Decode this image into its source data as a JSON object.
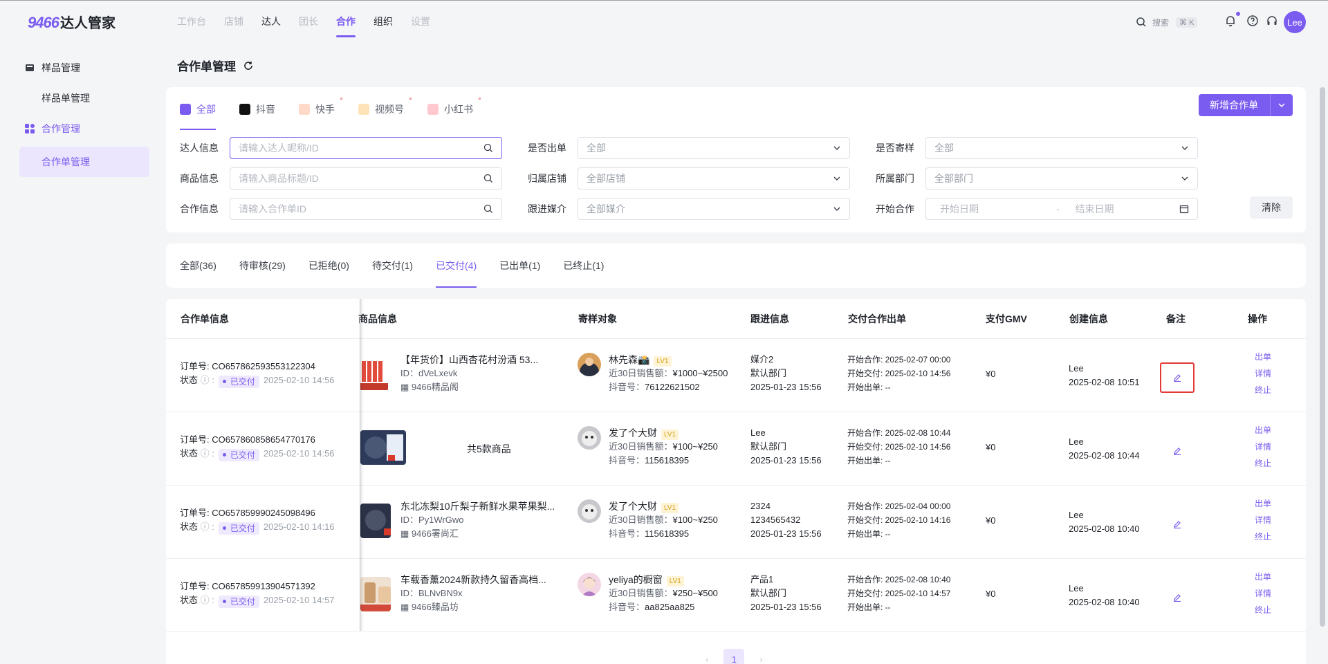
{
  "app": {
    "logo_num": "9466",
    "logo_text": "达人管家",
    "nav": [
      "工作台",
      "店铺",
      "达人",
      "团长",
      "合作",
      "组织",
      "设置"
    ],
    "search_label": "搜索",
    "search_kbd": "⌘ K",
    "avatar": "Lee"
  },
  "sidebar": {
    "group1": "样品管理",
    "item1": "样品单管理",
    "group2": "合作管理",
    "item2": "合作单管理"
  },
  "page": {
    "title": "合作单管理"
  },
  "platform_tabs": [
    {
      "label": "全部"
    },
    {
      "label": "抖音"
    },
    {
      "label": "快手"
    },
    {
      "label": "视频号"
    },
    {
      "label": "小红书"
    }
  ],
  "new_button": "新增合作单",
  "filters": {
    "talent_label": "达人信息",
    "talent_ph": "请输入达人昵称/ID",
    "product_label": "商品信息",
    "product_ph": "请输入商品标题/ID",
    "coop_label": "合作信息",
    "coop_ph": "请输入合作单ID",
    "order_label": "是否出单",
    "order_val": "全部",
    "store_label": "归属店铺",
    "store_val": "全部店铺",
    "media_label": "跟进媒介",
    "media_val": "全部媒介",
    "sample_label": "是否寄样",
    "sample_val": "全部",
    "dept_label": "所属部门",
    "dept_val": "全部部门",
    "start_label": "开始合作",
    "start_ph": "开始日期",
    "dash": "-",
    "end_ph": "结束日期",
    "clear": "清除"
  },
  "status_tabs": [
    "全部(36)",
    "待审核(29)",
    "已拒绝(0)",
    "待交付(1)",
    "已交付(4)",
    "已出单(1)",
    "已终止(1)"
  ],
  "columns": [
    "合作单信息",
    "商品信息",
    "寄样对象",
    "跟进信息",
    "交付合作出单",
    "支付GMV",
    "创建信息",
    "备注",
    "操作"
  ],
  "rows": [
    {
      "order_prefix": "订单号:",
      "order_no": "CO6578625935531223​04",
      "state_label": "状态",
      "state": "已交付",
      "state_time": "2025-02-10 14:56",
      "product_title": "【年货价】山西杏花村汾酒 53...",
      "product_id": "ID：dVeLxevk",
      "store": "9466精品阁",
      "talent": "林先森📸",
      "lv": "LV1",
      "sales_label": "近30日销售额：",
      "sales": "¥1000~¥2500",
      "dy_label": "抖音号：",
      "dy": "76122621502",
      "follow1": "媒介2",
      "follow2": "默认部门",
      "follow3": "2025-01-23 15:56",
      "start": "开始合作: 2025-02-07 00:00",
      "deliver": "开始交付: 2025-02-10 14:56",
      "out": "开始出单: --",
      "gmv": "¥0",
      "creator": "Lee",
      "created": "2025-02-08 10:51",
      "ops": [
        "出单",
        "详情",
        "终止"
      ]
    },
    {
      "order_prefix": "订单号:",
      "order_no": "CO6578608586547701​76",
      "state_label": "状态",
      "state": "已交付",
      "state_time": "2025-02-10 14:56",
      "product_summary": "共5款商品",
      "talent": "发了个大财",
      "lv": "LV1",
      "sales_label": "近30日销售额：",
      "sales": "¥100~¥250",
      "dy_label": "抖音号：",
      "dy": "115618395",
      "follow1": "Lee",
      "follow2": "默认部门",
      "follow3": "2025-01-23 15:56",
      "start": "开始合作: 2025-02-08 10:44",
      "deliver": "开始交付: 2025-02-10 14:56",
      "out": "开始出单: --",
      "gmv": "¥0",
      "creator": "Lee",
      "created": "2025-02-08 10:44",
      "ops": [
        "出单",
        "详情",
        "终止"
      ]
    },
    {
      "order_prefix": "订单号:",
      "order_no": "CO6578599902450984​96",
      "state_label": "状态",
      "state": "已交付",
      "state_time": "2025-02-10 14:16",
      "product_title": "东北冻梨10斤梨子新鲜水果苹果梨...",
      "product_id": "ID：Py1WrGwo",
      "store": "9466署尚汇",
      "talent": "发了个大财",
      "lv": "LV1",
      "sales_label": "近30日销售额：",
      "sales": "¥100~¥250",
      "dy_label": "抖音号：",
      "dy": "115618395",
      "follow1": "2324",
      "follow2": "1234565432",
      "follow3": "2025-01-23 15:56",
      "start": "开始合作: 2025-02-04 00:00",
      "deliver": "开始交付: 2025-02-10 14:16",
      "out": "开始出单: --",
      "gmv": "¥0",
      "creator": "Lee",
      "created": "2025-02-08 10:40",
      "ops": [
        "出单",
        "详情",
        "终止"
      ]
    },
    {
      "order_prefix": "订单号:",
      "order_no": "CO6578599139045713​92",
      "state_label": "状态",
      "state": "已交付",
      "state_time": "2025-02-10 14:57",
      "product_title": "车载香薰2024新款持久留香高档...",
      "product_id": "ID：BLNvBN9x",
      "store": "9466臻品坊",
      "talent": "yeliya的橱窗",
      "lv": "LV1",
      "sales_label": "近30日销售额：",
      "sales": "¥250~¥500",
      "dy_label": "抖音号：",
      "dy": "aa825aa825",
      "follow1": "产品1",
      "follow2": "默认部门",
      "follow3": "2025-01-23 15:56",
      "start": "开始合作: 2025-02-08 10:40",
      "deliver": "开始交付: 2025-02-10 14:57",
      "out": "开始出单: --",
      "gmv": "¥0",
      "creator": "Lee",
      "created": "2025-02-08 10:40",
      "ops": [
        "出单",
        "详情",
        "终止"
      ]
    }
  ],
  "pager": {
    "prev": "‹",
    "page": "1",
    "next": "›"
  },
  "colors": {
    "accent": "#7b5cf0",
    "highlight": "#e53935"
  }
}
